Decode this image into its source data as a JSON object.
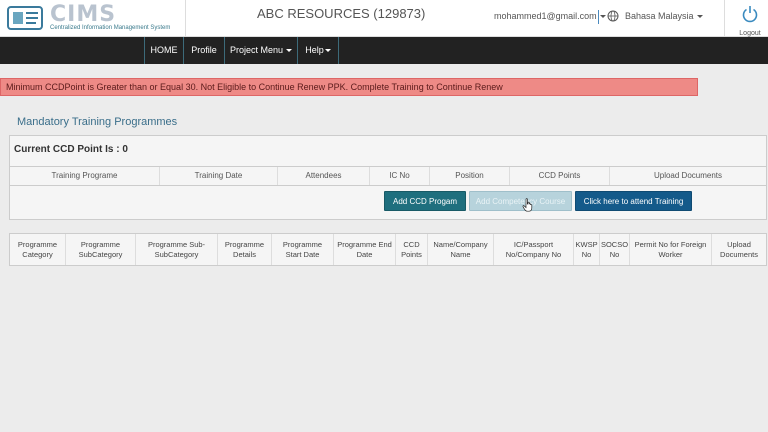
{
  "app": {
    "logo_text": "CIMS",
    "logo_subtitle": "Centralized Information Management System",
    "company": "ABC RESOURCES (129873)",
    "user_email": "mohammed1@gmail.com",
    "language": "Bahasa Malaysia",
    "logout_label": "Logout"
  },
  "nav": {
    "items": [
      {
        "label": "HOME"
      },
      {
        "label": "Profile"
      },
      {
        "label": "Project Menu"
      },
      {
        "label": "Help"
      }
    ]
  },
  "alert": {
    "text": "Minimum CCDPoint is Greater than or Equal 30. Not Eligible to Continue Renew PPK. Complete Training to Continue Renew"
  },
  "main": {
    "section_title": "Mandatory Training Programmes",
    "ccd_point_label": "Current CCD Point Is : 0",
    "training_table": {
      "headers": [
        "Training Programe",
        "Training Date",
        "Attendees",
        "IC No",
        "Position",
        "CCD Points",
        "Upload Documents"
      ]
    },
    "buttons": {
      "add_ccd": "Add CCD Progam",
      "add_competency": "Add Competency Course",
      "attend_training": "Click here to attend Training"
    },
    "program_table": {
      "headers": [
        "Programme Category",
        "Programme SubCategory",
        "Programme Sub-SubCategory",
        "Programme Details",
        "Programme Start Date",
        "Programme End Date",
        "CCD Points",
        "Name/Company Name",
        "IC/Passport No/Company No",
        "KWSP No",
        "SOCSO No",
        "Permit No for Foreign Worker",
        "Upload Documents"
      ]
    }
  },
  "colors": {
    "navbar": "#222222",
    "alert_bg": "#ee8a86",
    "btn_ccd": "#1f6f7e",
    "btn_comp_disabled": "#b7d3dc",
    "btn_attend": "#145a8a",
    "section_title": "#3a6e8a"
  },
  "icons": {
    "logo": "cims-logo-icon",
    "globe": "globe-icon",
    "logout": "power-icon",
    "cursor": "hand-pointer-icon"
  }
}
